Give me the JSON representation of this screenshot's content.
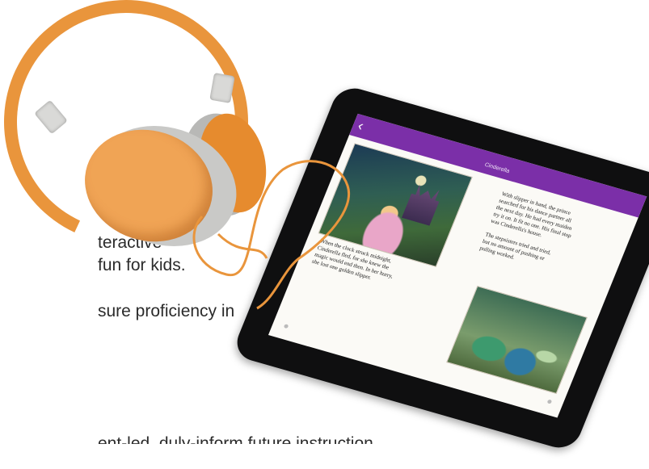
{
  "text_lines": {
    "line1": "teractive",
    "line2": "fun for kids.",
    "line3": "sure proficiency in",
    "line4": "ent-led, duly-inform future instruction"
  },
  "tablet": {
    "app_title": "Cinderella",
    "back_icon": "chevron-left-icon",
    "left_caption": "When the clock struck midnight,\nCinderella fled, for she knew the\nmagic would end then. In her hurry,\nshe lost one golden slipper.",
    "right_caption_1": "With slipper in hand, the prince\nsearched for his dance partner all\nthe next day. He had every maiden\ntry it on. It fit no one. His final stop\nwas Cinderella's house.",
    "right_caption_2": "The stepsisters tried and tried,\nbut no amount of pushing or\npulling worked."
  },
  "colors": {
    "appbar": "#7b2fa8",
    "headphone_orange": "#e9953c",
    "tablet_body": "#0f0f10"
  }
}
